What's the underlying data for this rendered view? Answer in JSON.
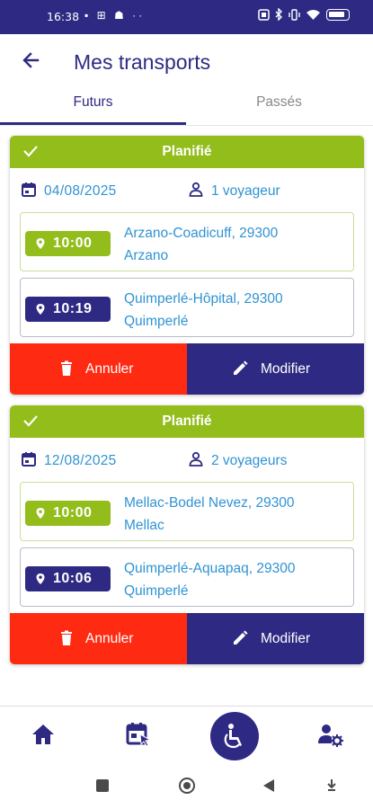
{
  "status_bar": {
    "time": "16:38",
    "left_icons": "▪ ⊞ ☗ ··"
  },
  "header": {
    "title": "Mes transports"
  },
  "tabs": [
    {
      "label": "Futurs",
      "active": true
    },
    {
      "label": "Passés",
      "active": false
    }
  ],
  "transports": [
    {
      "status": "Planifié",
      "date": "04/08/2025",
      "passengers": "1 voyageur",
      "pickup": {
        "time": "10:00",
        "address_line1": "Arzano-Coadicuff, 29300",
        "address_line2": "Arzano"
      },
      "dropoff": {
        "time": "10:19",
        "address_line1": "Quimperlé-Hôpital, 29300",
        "address_line2": "Quimperlé"
      },
      "cancel_label": "Annuler",
      "edit_label": "Modifier"
    },
    {
      "status": "Planifié",
      "date": "12/08/2025",
      "passengers": "2 voyageurs",
      "pickup": {
        "time": "10:00",
        "address_line1": "Mellac-Bodel Nevez, 29300",
        "address_line2": "Mellac"
      },
      "dropoff": {
        "time": "10:06",
        "address_line1": "Quimperlé-Aquapaq, 29300",
        "address_line2": "Quimperlé"
      },
      "cancel_label": "Annuler",
      "edit_label": "Modifier"
    }
  ],
  "bottom_nav": [
    {
      "icon": "home-icon"
    },
    {
      "icon": "calendar-select-icon"
    },
    {
      "icon": "wheelchair-icon",
      "active": true
    },
    {
      "icon": "user-settings-icon"
    }
  ],
  "colors": {
    "primary": "#2e2a83",
    "planned_green": "#92bd1b",
    "cancel_red": "#ff2a12",
    "text_blue": "#2f93d4"
  }
}
